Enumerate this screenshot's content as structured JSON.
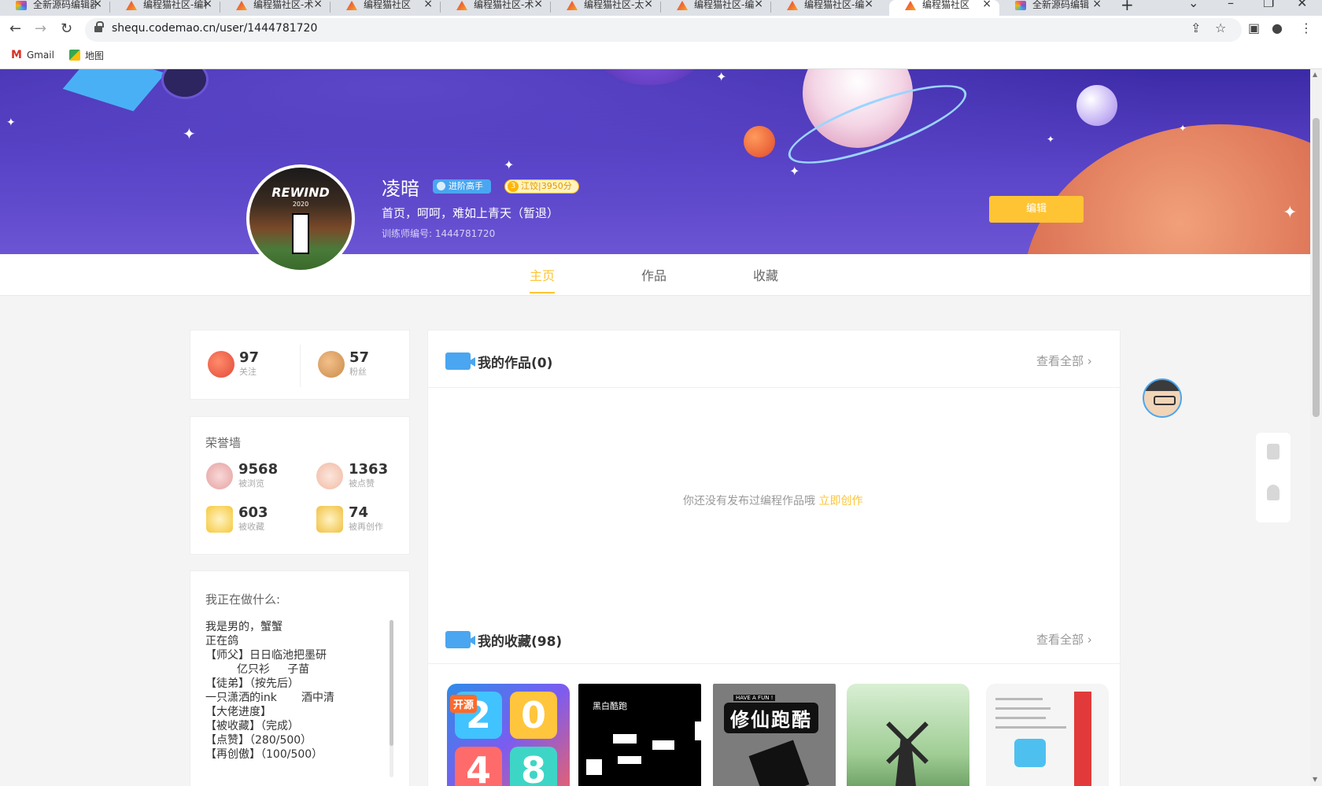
{
  "browser": {
    "tabs": [
      {
        "title": "全新源码编辑器",
        "favicon": "qr-icon",
        "active": false
      },
      {
        "title": "编程猫社区-编程",
        "favicon": "codemao-icon",
        "active": false
      },
      {
        "title": "编程猫社区-术",
        "favicon": "codemao-icon",
        "active": false
      },
      {
        "title": "编程猫社区",
        "favicon": "codemao-icon",
        "active": false
      },
      {
        "title": "编程猫社区-术",
        "favicon": "codemao-icon",
        "active": false
      },
      {
        "title": "编程猫社区-太",
        "favicon": "codemao-icon",
        "active": false
      },
      {
        "title": "编程猫社区-编",
        "favicon": "codemao-icon",
        "active": false
      },
      {
        "title": "编程猫社区-编",
        "favicon": "codemao-icon",
        "active": false
      },
      {
        "title": "编程猫社区",
        "favicon": "codemao-icon",
        "active": true
      },
      {
        "title": "全新源码编辑",
        "favicon": "qr-icon",
        "active": false
      }
    ],
    "url": "shequ.codemao.cn/user/1444781720",
    "bookmarks": [
      {
        "label": "Gmail",
        "icon": "gmail-icon"
      },
      {
        "label": "地图",
        "icon": "maps-icon"
      }
    ]
  },
  "profile": {
    "name": "凌暗",
    "badge_level": "进阶高手",
    "badge_rank_number": "3",
    "badge_rank": "江饺|3950分",
    "motto": "首页，呵呵，难如上青天（暂退）",
    "trainer_id": "训练师编号: 1444781720",
    "avatar": {
      "title": "REWIND",
      "subtitle": "2020"
    },
    "edit_label": "编辑"
  },
  "nav_tabs": [
    {
      "label": "主页",
      "active": true
    },
    {
      "label": "作品",
      "active": false
    },
    {
      "label": "收藏",
      "active": false
    }
  ],
  "follow": {
    "following": {
      "value": "97",
      "label": "关注"
    },
    "fans": {
      "value": "57",
      "label": "粉丝"
    }
  },
  "honor": {
    "title": "荣誉墙",
    "items": [
      {
        "value": "9568",
        "label": "被浏览"
      },
      {
        "value": "1363",
        "label": "被点赞"
      },
      {
        "value": "603",
        "label": "被收藏"
      },
      {
        "value": "74",
        "label": "被再创作"
      }
    ]
  },
  "doing": {
    "title": "我正在做什么:",
    "text": "我是男的，蟹蟹\n正在鸽\n【师父】日日临池把墨研\n         亿只衫     子苗\n【徒弟】（按先后）\n一只潇洒的ink       酒中清\n【大佬进度】\n【被收藏】（完成）\n【点赞】（280/500）\n【再创傲】（100/500）"
  },
  "works": {
    "title": "我的作品(0)",
    "view_all": "查看全部",
    "empty_text": "你还没有发布过编程作品哦",
    "empty_link": "立即创作"
  },
  "collections": {
    "title": "我的收藏(98)",
    "view_all": "查看全部",
    "thumbs": {
      "c1_tag": "开源",
      "c1_tiles": [
        "2",
        "0",
        "4",
        "8"
      ],
      "c2_label": "黑白酷跑",
      "c3_title": "修仙跑酷",
      "c3_small": "HAVE A FUN !"
    }
  }
}
